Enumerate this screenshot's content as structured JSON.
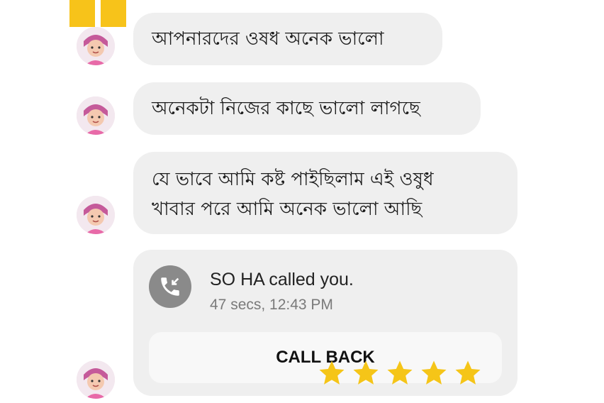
{
  "messages": [
    {
      "text": "আপনারদের ওষধ অনেক ভালো"
    },
    {
      "text": "অনেকটা নিজের কাছে ভালো লাগছে"
    },
    {
      "line1": "যে ভাবে আমি কষ্ট পাইছিলাম  এই ওষুধ",
      "line2": "খাবার  পরে  আমি অনেক ভালো আছি"
    }
  ],
  "call": {
    "title": "SO HA called you.",
    "meta": "47 secs, 12:43 PM",
    "button_label": "CALL BACK"
  },
  "rating": {
    "stars": 5,
    "color": "#f5c518"
  },
  "colors": {
    "bubble": "#efefef",
    "accent": "#f7c31a"
  }
}
